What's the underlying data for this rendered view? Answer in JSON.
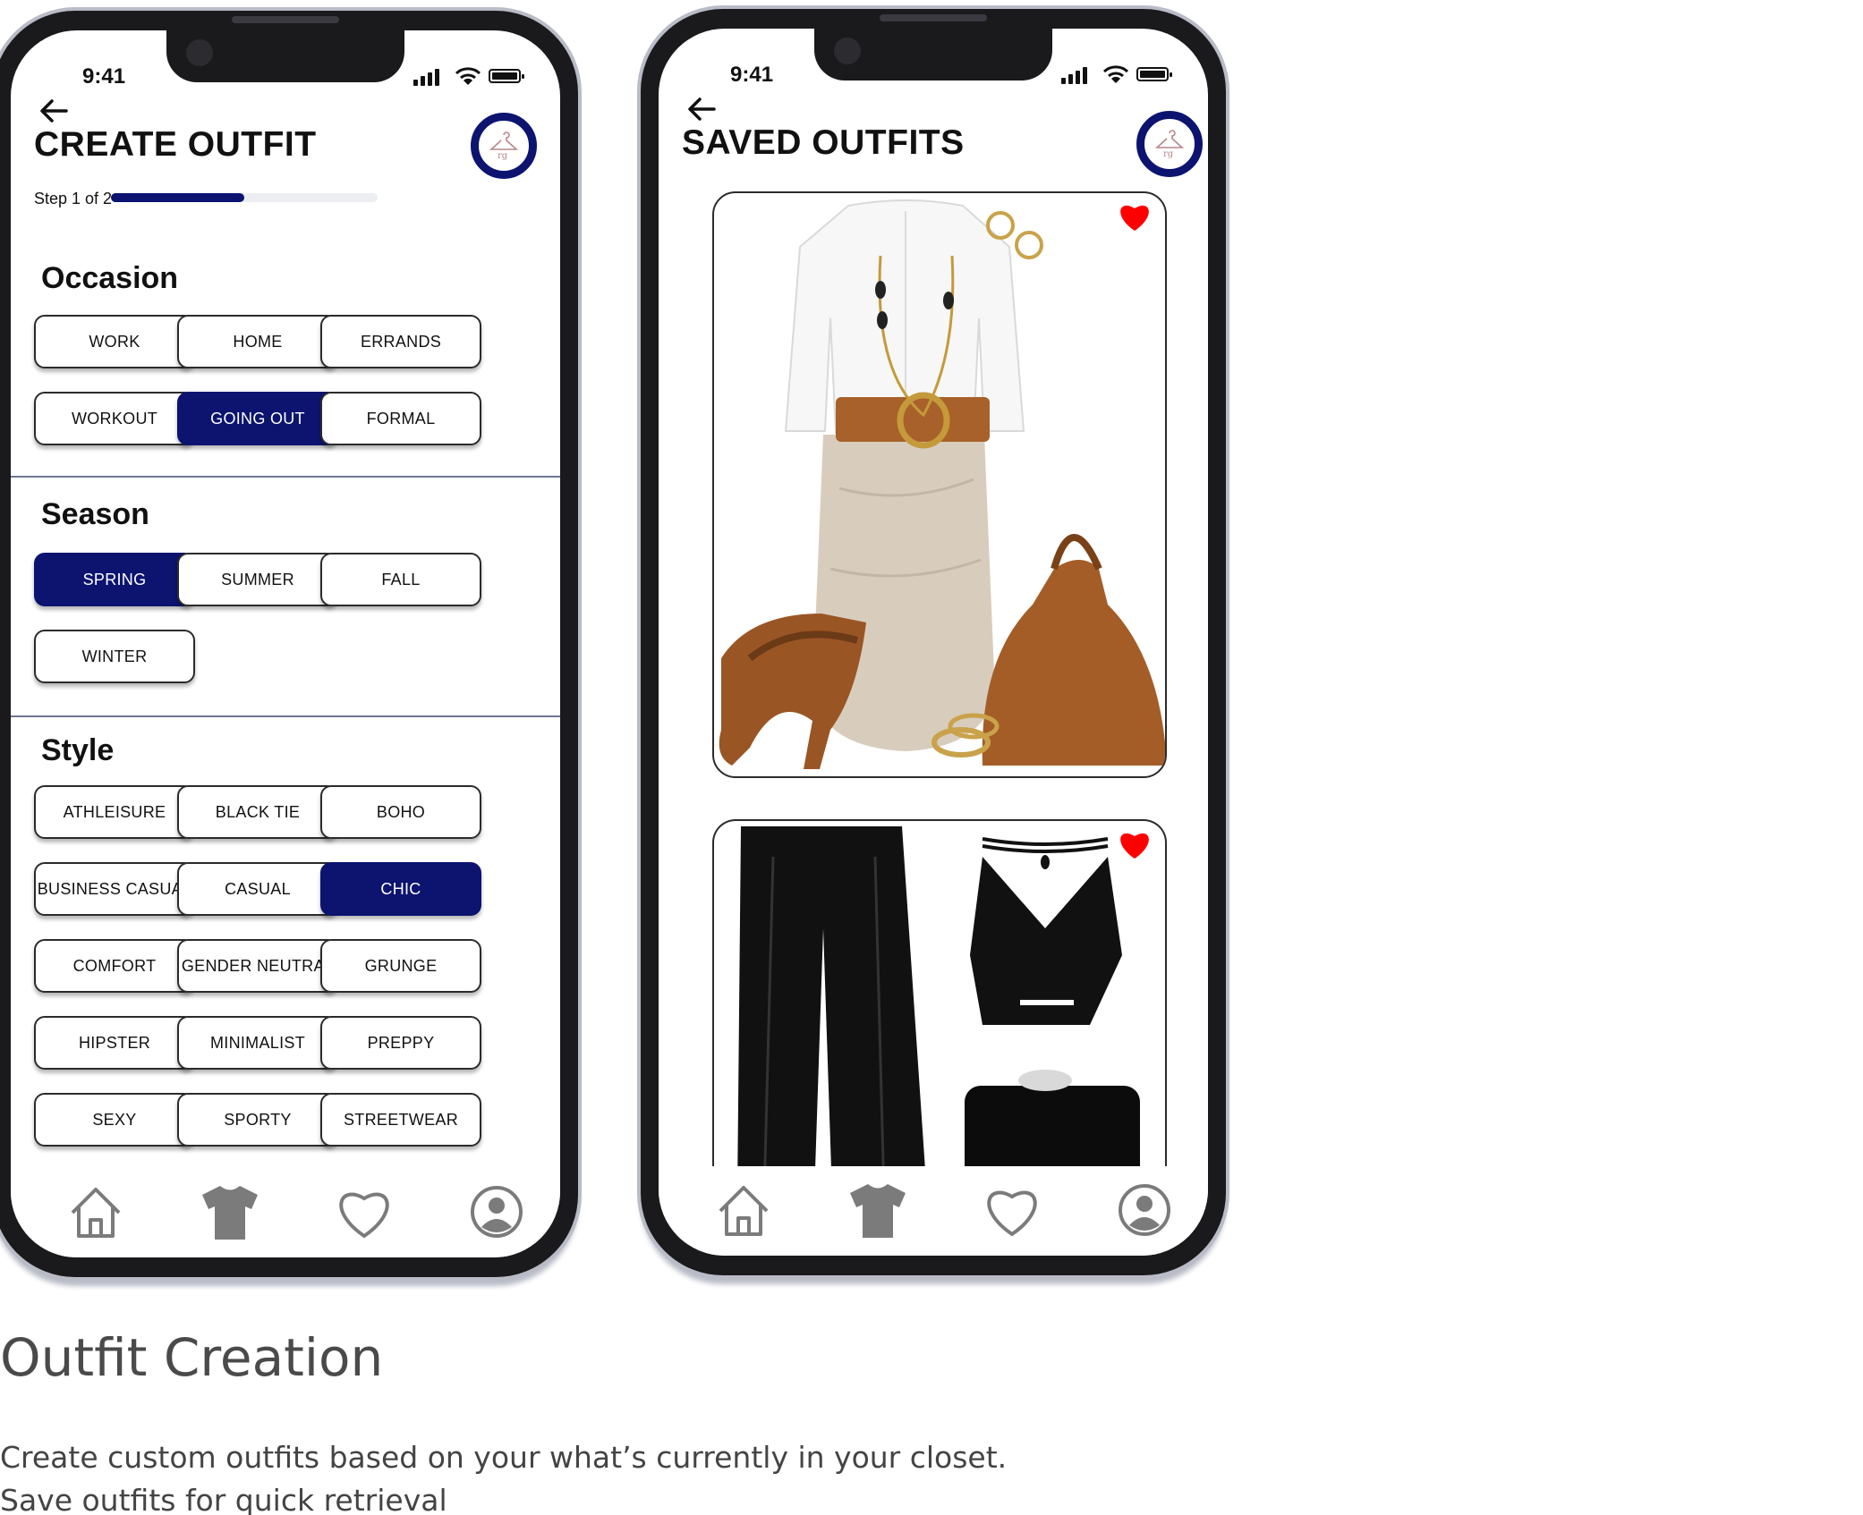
{
  "status": {
    "time": "9:41"
  },
  "create": {
    "title": "CREATE OUTFIT",
    "step_label": "Step 1 of 2",
    "progress": 0.5,
    "occasion": {
      "title": "Occasion",
      "options": [
        "WORK",
        "HOME",
        "ERRANDS",
        "WORKOUT",
        "GOING OUT",
        "FORMAL"
      ],
      "selected": "GOING OUT"
    },
    "season": {
      "title": "Season",
      "options": [
        "SPRING",
        "SUMMER",
        "FALL",
        "WINTER"
      ],
      "selected": "SPRING"
    },
    "style": {
      "title": "Style",
      "options": [
        "ATHLEISURE",
        "BLACK TIE",
        "BOHO",
        "BUSINESS CASUAL",
        "CASUAL",
        "CHIC",
        "COMFORT",
        "GENDER NEUTRAL",
        "GRUNGE",
        "HIPSTER",
        "MINIMALIST",
        "PREPPY",
        "SEXY",
        "SPORTY",
        "STREETWEAR"
      ],
      "selected": "CHIC"
    }
  },
  "saved": {
    "title": "SAVED OUTFITS",
    "favorites": [
      true,
      true
    ]
  },
  "tabs": [
    "home-icon",
    "shirt-icon",
    "heart-icon",
    "profile-icon"
  ],
  "colors": {
    "accent": "#0c1470",
    "favorite": "#ff0000",
    "tab_icon": "#7b7b7b"
  },
  "caption": {
    "title": "Outfit Creation",
    "line1": "Create custom outfits based on your what’s currently in your closet.",
    "line2": "Save outfits for quick retrieval"
  }
}
